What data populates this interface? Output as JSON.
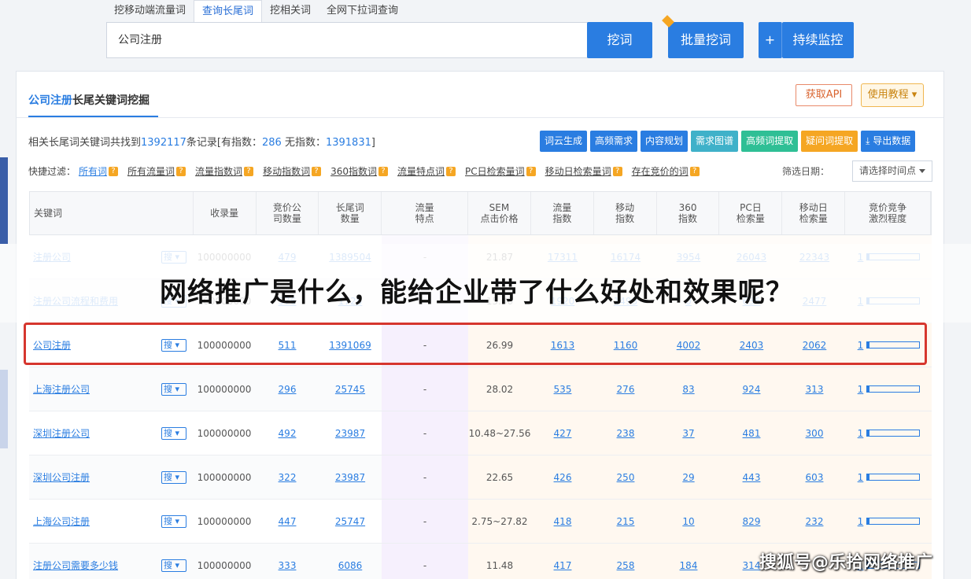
{
  "top_tabs": [
    "挖移动端流量词",
    "查询长尾词",
    "挖相关词",
    "全网下拉词查询"
  ],
  "search": {
    "value": "公司注册",
    "button": "挖词",
    "batch": "批量挖词",
    "plus": "+",
    "monitor": "持续监控"
  },
  "panel": {
    "title_hl": "公司注册",
    "title_rest": "长尾关键词挖掘",
    "api": "获取API",
    "tutorial": "使用教程 ▾",
    "summary_prefix": "相关长尾词关键词共找到",
    "summary_total": "1392117",
    "summary_mid": "条记录[有指数：",
    "summary_with": "286",
    "summary_mid2": " 无指数：",
    "summary_without": "1391831",
    "summary_end": "]",
    "actions": [
      {
        "label": "词云生成",
        "color": "#2a7de1"
      },
      {
        "label": "高频需求",
        "color": "#2a7de1"
      },
      {
        "label": "内容规划",
        "color": "#2a7de1"
      },
      {
        "label": "需求图谱",
        "color": "#3fb1c9"
      },
      {
        "label": "高频词提取",
        "color": "#2fbf95"
      },
      {
        "label": "疑问词提取",
        "color": "#f5a623"
      },
      {
        "label": "⤓ 导出数据",
        "color": "#2a7de1"
      }
    ],
    "filter_label": "快捷过滤：",
    "filters": [
      "所有词",
      "所有流量词",
      "流量指数词",
      "移动指数词",
      "360指数词",
      "流量特点词",
      "PC日检索量词",
      "移动日检索量词",
      "存在竞价的词"
    ],
    "date_label": "筛选日期：",
    "date_placeholder": "请选择时间点"
  },
  "columns": [
    "关键词",
    "收录量",
    "竞价公\n司数量",
    "长尾词\n数量",
    "流量\n特点",
    "SEM\n点击价格",
    "流量\n指数",
    "移动\n指数",
    "360\n指数",
    "PC日\n检索量",
    "移动日\n检索量",
    "竞价竞争\n激烈程度"
  ],
  "search_tag": "搜 ▾",
  "rows": [
    [
      "注册公司",
      "100000000",
      "479",
      "1389504",
      "-",
      "21.87",
      "17311",
      "16174",
      "3954",
      "26043",
      "22343",
      "1"
    ],
    [
      "注册公司流程和费用",
      "100000000",
      "576",
      "1728",
      "",
      "15.30",
      "1920",
      "1493",
      "0",
      "636",
      "2477",
      "1"
    ],
    [
      "公司注册",
      "100000000",
      "511",
      "1391069",
      "-",
      "26.99",
      "1613",
      "1160",
      "4002",
      "2403",
      "2062",
      "1"
    ],
    [
      "上海注册公司",
      "100000000",
      "296",
      "25745",
      "-",
      "28.02",
      "535",
      "276",
      "83",
      "924",
      "313",
      "1"
    ],
    [
      "深圳注册公司",
      "100000000",
      "492",
      "23987",
      "-",
      "10.48~27.56",
      "427",
      "238",
      "37",
      "481",
      "300",
      "1"
    ],
    [
      "深圳公司注册",
      "100000000",
      "322",
      "23987",
      "-",
      "22.65",
      "426",
      "250",
      "29",
      "443",
      "603",
      "1"
    ],
    [
      "上海公司注册",
      "100000000",
      "447",
      "25747",
      "-",
      "2.75~27.82",
      "418",
      "215",
      "10",
      "829",
      "232",
      "1"
    ],
    [
      "注册公司需要多少钱",
      "100000000",
      "333",
      "6086",
      "-",
      "11.48",
      "417",
      "258",
      "184",
      "314",
      "",
      "1"
    ]
  ],
  "bar_fraction": 0.04,
  "overlay_title": "网络推广是什么，能给企业带了什么好处和效果呢？",
  "watermark": "搜狐号@乐拾网络推广"
}
